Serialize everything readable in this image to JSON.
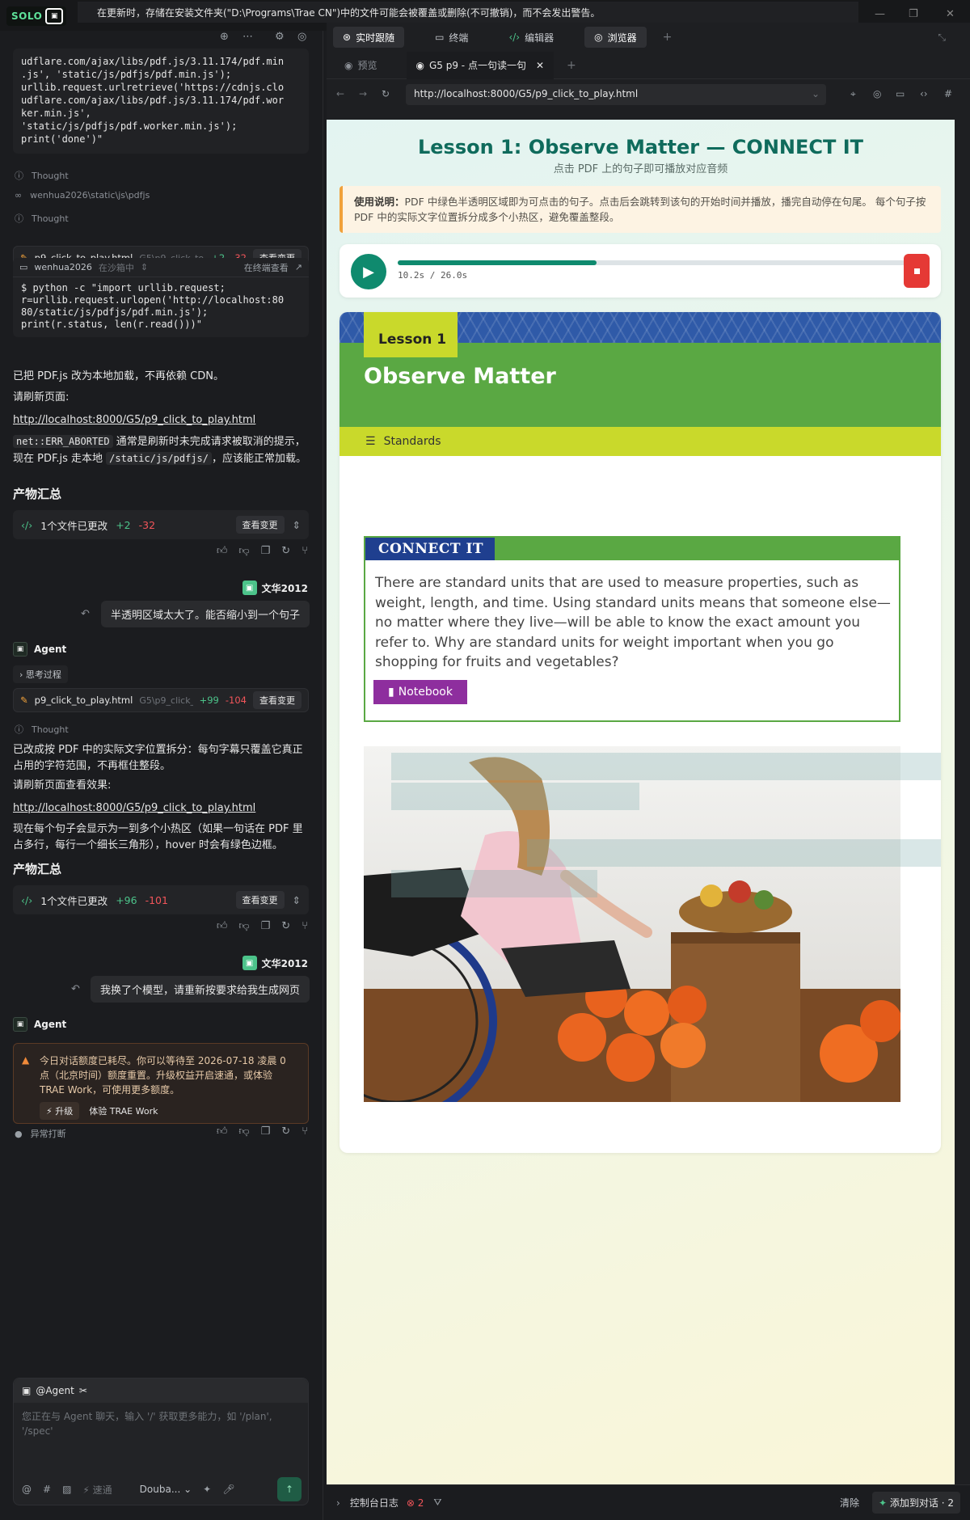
{
  "titlebar": {
    "logo": "SOLO",
    "project": "wenhua2026",
    "warning": "在更新时，存储在安装文件夹(\"D:\\Programs\\Trae CN\")中的文件可能会被覆盖或删除(不可撤销)，而不会发出警告。"
  },
  "chat": {
    "code1": "udflare.com/ajax/libs/pdf.js/3.11.174/pdf.min\n.js', 'static/js/pdfjs/pdf.min.js');\nurllib.request.urlretrieve('https://cdnjs.clo\nudflare.com/ajax/libs/pdf.js/3.11.174/pdf.wor\nker.min.js',\n'static/js/pdfjs/pdf.worker.min.js');\nprint('done')\"",
    "thought": "Thought",
    "path_ref": "wenhua2026\\static\\js\\pdfjs",
    "file1": {
      "name": "p9_click_to_play.html",
      "path": "G5\\p9_click_to_p...",
      "add": "+2",
      "del": "-32",
      "btn": "查看变更"
    },
    "terminal": {
      "name": "wenhua2026",
      "sandbox": "在沙箱中",
      "open": "在终端查看",
      "cmd": "$ python -c \"import urllib.request;\nr=urllib.request.urlopen('http://localhost:80\n80/static/js/pdfjs/pdf.min.js');\nprint(r.status, len(r.read()))\""
    },
    "msg1": "已把 PDF.js 改为本地加载，不再依赖 CDN。",
    "refresh1": "请刷新页面:",
    "url": "http://localhost:8000/G5/p9_click_to_play.html",
    "err_code": "net::ERR_ABORTED",
    "err_text1": " 通常是刷新时未完成请求被取消的提示，现在 PDF.js 走本地 ",
    "err_path": "/static/js/pdfjs/",
    "err_text2": "，应该能正常加载。",
    "summary_title": "产物汇总",
    "summary1": {
      "text": "1个文件已更改",
      "add": "+2",
      "del": "-32",
      "btn": "查看变更"
    },
    "user": "文华2012",
    "user_msg1": "半透明区域太大了。能否缩小到一个句子",
    "agent": "Agent",
    "thinking": "思考过程",
    "file2": {
      "name": "p9_click_to_play.html",
      "path": "G5\\p9_click_to...",
      "add": "+99",
      "del": "-104",
      "btn": "查看变更"
    },
    "msg2": "已改成按 PDF 中的实际文字位置拆分：每句字幕只覆盖它真正占用的字符范围，不再框住整段。",
    "refresh2": "请刷新页面查看效果:",
    "msg3": "现在每个句子会显示为一到多个小热区（如果一句话在 PDF 里占多行，每行一个细长三角形），hover 时会有绿色边框。",
    "summary2": {
      "text": "1个文件已更改",
      "add": "+96",
      "del": "-101",
      "btn": "查看变更"
    },
    "user_msg2": "我换了个模型，请重新按要求给我生成网页",
    "quota": "今日对话额度已耗尽。你可以等待至 2026-07-18 凌晨 0 点（北京时间）额度重置。升级权益开启速通，或体验 TRAE Work，可使用更多额度。",
    "upgrade": "升级",
    "try_work": "体验 TRAE Work",
    "aborted": "异常打断",
    "input": {
      "mention": "@Agent",
      "placeholder": "您正在与 Agent 聊天，输入 '/' 获取更多能力，如 '/plan', '/spec'",
      "speed": "速通",
      "model": "Douba..."
    }
  },
  "ide": {
    "tabs": [
      "实时跟随",
      "终端",
      "编辑器",
      "浏览器"
    ],
    "browser_tabs": [
      "预览",
      "G5 p9 - 点一句读一句"
    ],
    "url": "http://localhost:8000/G5/p9_click_to_play.html",
    "console": "控制台日志",
    "errors": "2",
    "clear": "清除",
    "add_chat": "添加到对话 · 2"
  },
  "page": {
    "title": "Lesson 1: Observe Matter — CONNECT IT",
    "subtitle": "点击 PDF 上的句子即可播放对应音频",
    "info_label": "使用说明：",
    "info_text": "PDF 中绿色半透明区域即为可点击的句子。点击后会跳转到该句的开始时间并播放，播完自动停在句尾。 每个句子按 PDF 中的实际文字位置拆分成多个小热区，避免覆盖整段。",
    "player": {
      "time": "10.2s / 26.0s",
      "progress": 0.39
    }
  },
  "pdf": {
    "lesson_tag": "Lesson 1",
    "heading": "Observe Matter",
    "standards": "Standards",
    "connect_tag": "CONNECT IT",
    "connect_text": "There are standard units that are used to measure properties, such as weight, length, and time. Using standard units means that someone else—no matter where they live—will be able to know the exact amount you refer to. Why are standard units for weight important when you go shopping for fruits and vegetables?",
    "notebook": "Notebook"
  },
  "colors": {
    "accent": "#0f8a6e",
    "add": "#4cc38a",
    "del": "#f2555a",
    "banner_green": "#5aa843",
    "lime": "#c9d92b",
    "navy": "#1f3f8f",
    "purple": "#8e2e9e"
  }
}
